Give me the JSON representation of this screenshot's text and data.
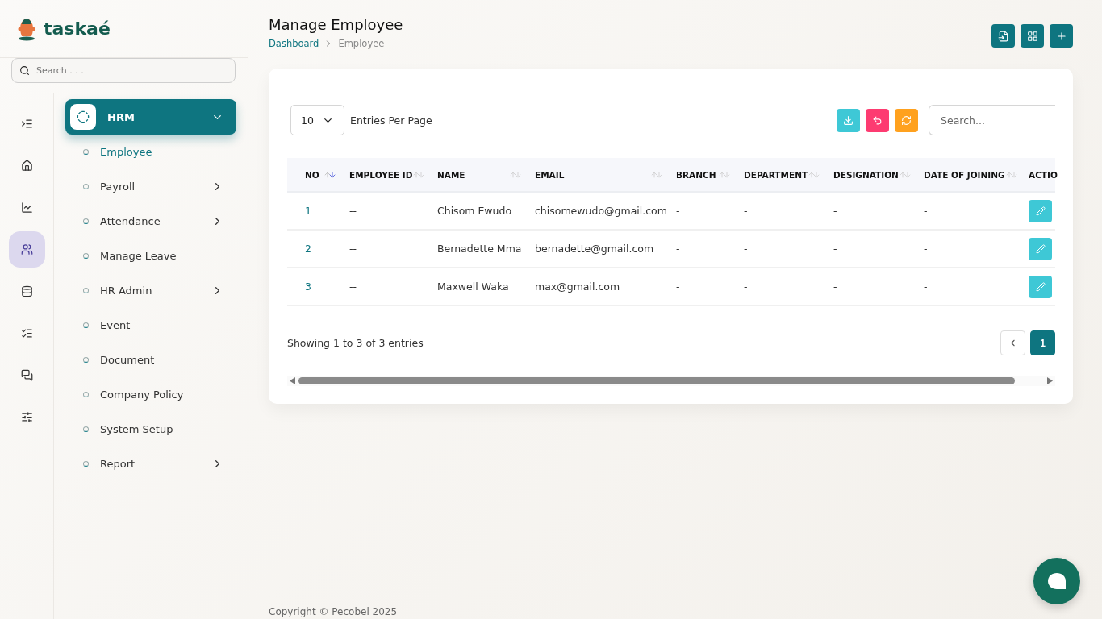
{
  "brand": {
    "name": "taskaé"
  },
  "sidebar": {
    "search": {
      "placeholder": "Search . . ."
    },
    "rail": [
      {
        "kind": "collapse",
        "selected": false
      },
      {
        "kind": "home",
        "selected": false
      },
      {
        "kind": "chart",
        "selected": false
      },
      {
        "kind": "users",
        "selected": true
      },
      {
        "kind": "finance",
        "selected": false
      },
      {
        "kind": "tasks",
        "selected": false
      },
      {
        "kind": "chat",
        "selected": false
      },
      {
        "kind": "settings",
        "selected": false
      }
    ],
    "group": {
      "label": "HRM",
      "expanded": true,
      "items": [
        {
          "label": "Employee",
          "selected": true,
          "has_submenu": false
        },
        {
          "label": "Payroll",
          "selected": false,
          "has_submenu": true
        },
        {
          "label": "Attendance",
          "selected": false,
          "has_submenu": true
        },
        {
          "label": "Manage Leave",
          "selected": false,
          "has_submenu": false
        },
        {
          "label": "HR Admin",
          "selected": false,
          "has_submenu": true
        },
        {
          "label": "Event",
          "selected": false,
          "has_submenu": false
        },
        {
          "label": "Document",
          "selected": false,
          "has_submenu": false
        },
        {
          "label": "Company Policy",
          "selected": false,
          "has_submenu": false
        },
        {
          "label": "System Setup",
          "selected": false,
          "has_submenu": false
        },
        {
          "label": "Report",
          "selected": false,
          "has_submenu": true
        }
      ]
    }
  },
  "page": {
    "title": "Manage Employee",
    "breadcrumb": [
      "Dashboard",
      "Employee"
    ],
    "actions": [
      {
        "kind": "import"
      },
      {
        "kind": "grid"
      },
      {
        "kind": "add"
      }
    ]
  },
  "table": {
    "page_size": "10",
    "page_size_label": "Entries Per Page",
    "tools": [
      {
        "kind": "download",
        "color": "#3ec8d6"
      },
      {
        "kind": "undo",
        "color": "#fd3b71"
      },
      {
        "kind": "refresh",
        "color": "#ffa11e"
      }
    ],
    "search": {
      "placeholder": "Search..."
    },
    "columns": [
      {
        "label": "NO",
        "sorted": true
      },
      {
        "label": "EMPLOYEE ID",
        "sorted": false
      },
      {
        "label": "NAME",
        "sorted": false
      },
      {
        "label": "EMAIL",
        "sorted": false
      },
      {
        "label": "BRANCH",
        "sorted": false
      },
      {
        "label": "DEPARTMENT",
        "sorted": false
      },
      {
        "label": "DESIGNATION",
        "sorted": false
      },
      {
        "label": "DATE OF JOINING",
        "sorted": false
      },
      {
        "label": "ACTIO"
      }
    ],
    "rows": [
      [
        "1",
        "--",
        "Chisom Ewudo",
        "chisomewudo@gmail.com",
        "-",
        "-",
        "-",
        "-"
      ],
      [
        "2",
        "--",
        "Bernadette Mma",
        "bernadette@gmail.com",
        "-",
        "-",
        "-",
        "-"
      ],
      [
        "3",
        "--",
        "Maxwell Waka",
        "max@gmail.com",
        "-",
        "-",
        "-",
        "-"
      ]
    ],
    "summary": "Showing 1 to 3 of 3 entries",
    "pages": [
      {
        "label": "1",
        "selected": true
      }
    ]
  },
  "footer": "Copyright © Pecobel 2025"
}
